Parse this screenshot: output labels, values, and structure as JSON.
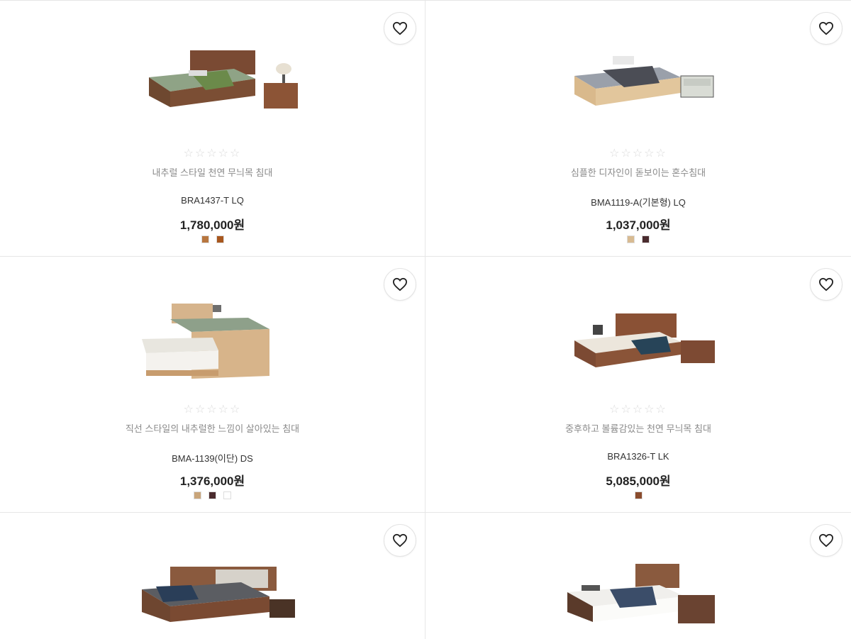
{
  "stars_glyph": "☆☆☆☆☆",
  "products": [
    {
      "desc": "내추럴 스타일 천연 무늬목 침대",
      "model": "BRA1437-T LQ",
      "price": "1,780,000원",
      "swatches": [
        "#b8763f",
        "#a8571e"
      ]
    },
    {
      "desc": "심플한 디자인이 돋보이는 혼수침대",
      "model": "BMA1119-A(기본형) LQ",
      "price": "1,037,000원",
      "swatches": [
        "#d8bb92",
        "#4a2b2e"
      ]
    },
    {
      "desc": "직선 스타일의 내추럴한 느낌이 살아있는 침대",
      "model": "BMA-1139(이단) DS",
      "price": "1,376,000원",
      "swatches": [
        "#c9a57a",
        "#4a2b2e",
        "#ffffff"
      ]
    },
    {
      "desc": "중후하고 볼륨감있는 천연 무늬목 침대",
      "model": "BRA1326-T LK",
      "price": "5,085,000원",
      "swatches": [
        "#8a4c2e"
      ]
    },
    {
      "desc": "",
      "model": "",
      "price": "",
      "swatches": []
    },
    {
      "desc": "",
      "model": "",
      "price": "",
      "swatches": []
    }
  ],
  "icons": {
    "wishlist": "heart-outline-icon",
    "product_image": "bed-product-image"
  },
  "colors": {
    "border": "#e6e6e6",
    "star": "#d9d9d9",
    "desc_text": "#8a8a8a"
  }
}
